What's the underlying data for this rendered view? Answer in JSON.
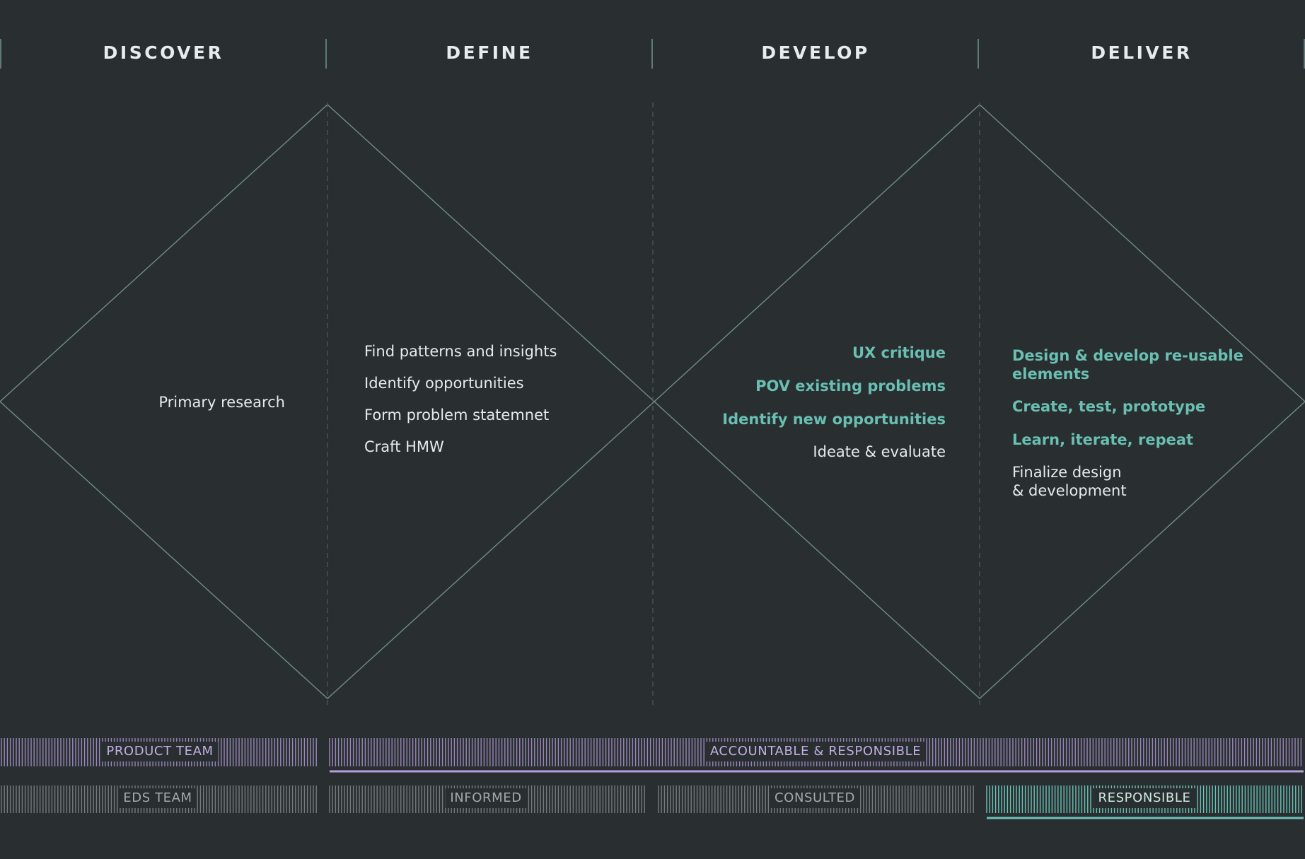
{
  "colors": {
    "background": "#292e31",
    "diamond_line": "#6f8c89",
    "divider": "#5f7a79",
    "teal_text": "#69bfb2",
    "white_text": "#e6eaea",
    "purple": "#b79fdc",
    "gray": "#7e8486",
    "teal_bar": "#6cc3b6"
  },
  "phases": [
    "DISCOVER",
    "DEFINE",
    "DEVELOP",
    "DELIVER"
  ],
  "discover": {
    "items": [
      "Primary research"
    ]
  },
  "define": {
    "items": [
      "Find patterns and insights",
      "Identify opportunities",
      "Form problem statemnet",
      "Craft HMW"
    ]
  },
  "develop": {
    "items": [
      "UX critique",
      "POV existing problems",
      "Identify new opportunities",
      "Ideate & evaluate"
    ]
  },
  "deliver": {
    "items": [
      "Design & develop re-usable\n elements",
      "Create, test, prototype",
      "Learn, iterate, repeat",
      "Finalize design\n & development"
    ]
  },
  "bands": {
    "product_team": "PRODUCT TEAM",
    "accountable": "ACCOUNTABLE & RESPONSIBLE",
    "eds_team": "EDS TEAM",
    "informed": "INFORMED",
    "consulted": "CONSULTED",
    "responsible": "RESPONSIBLE"
  }
}
